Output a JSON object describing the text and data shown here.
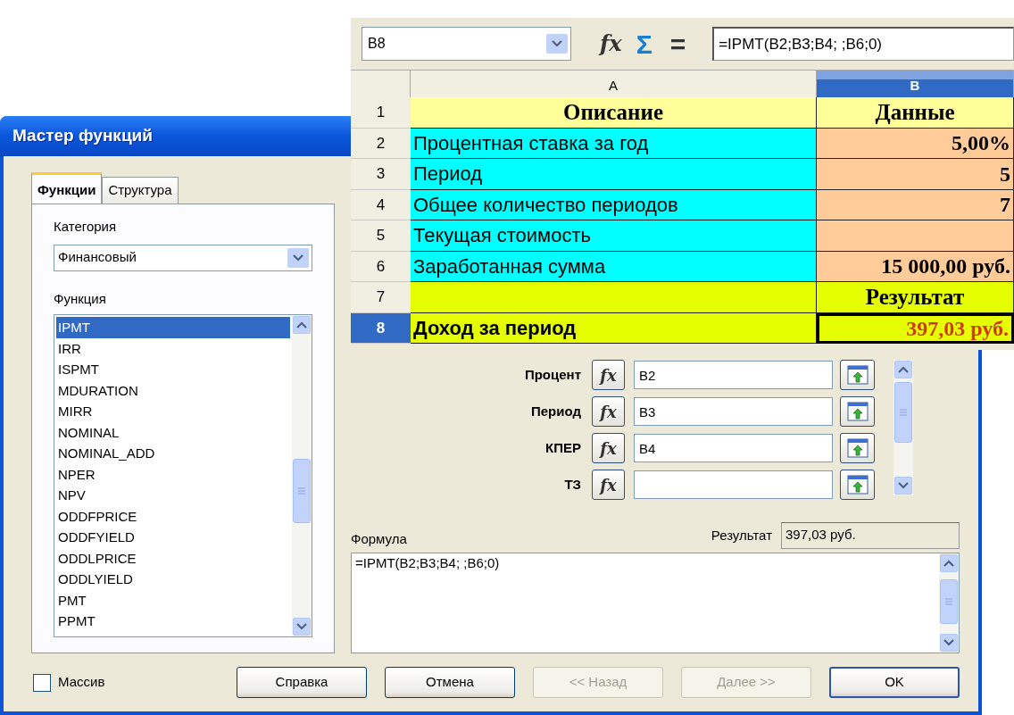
{
  "dialog": {
    "title": "Мастер функций",
    "tabs": [
      {
        "label": "Функции",
        "selected": true
      },
      {
        "label": "Структура",
        "selected": false
      }
    ],
    "category": {
      "label": "Категория",
      "value": "Финансовый"
    },
    "function_list": {
      "label": "Функция",
      "items": [
        {
          "label": "IPMT",
          "selected": true
        },
        {
          "label": "IRR",
          "selected": false
        },
        {
          "label": "ISPMT",
          "selected": false
        },
        {
          "label": "MDURATION",
          "selected": false
        },
        {
          "label": "MIRR",
          "selected": false
        },
        {
          "label": "NOMINAL",
          "selected": false
        },
        {
          "label": "NOMINAL_ADD",
          "selected": false
        },
        {
          "label": "NPER",
          "selected": false
        },
        {
          "label": "NPV",
          "selected": false
        },
        {
          "label": "ODDFPRICE",
          "selected": false
        },
        {
          "label": "ODDFYIELD",
          "selected": false
        },
        {
          "label": "ODDLPRICE",
          "selected": false
        },
        {
          "label": "ODDLYIELD",
          "selected": false
        },
        {
          "label": "PMT",
          "selected": false
        },
        {
          "label": "PPMT",
          "selected": false
        }
      ]
    },
    "array_checkbox": {
      "label": "Массив",
      "checked": false
    },
    "arguments": [
      {
        "label": "Процент",
        "fx": "fx",
        "value": "B2"
      },
      {
        "label": "Период",
        "fx": "fx",
        "value": "B3"
      },
      {
        "label": "КПЕР",
        "fx": "fx",
        "value": "B4"
      },
      {
        "label": "ТЗ",
        "fx": "fx"
      }
    ],
    "formula": {
      "label": "Формула",
      "value": "=IPMT(B2;B3;B4; ;B6;0)"
    },
    "result": {
      "label": "Результат",
      "value": "397,03 руб."
    },
    "buttons": [
      {
        "label": "Справка",
        "disabled": false,
        "default": false
      },
      {
        "label": "Отмена",
        "disabled": false,
        "default": false
      },
      {
        "label": "<< Назад",
        "disabled": true,
        "default": false
      },
      {
        "label": "Далее >>",
        "disabled": true,
        "default": false
      },
      {
        "label": "OK",
        "disabled": false,
        "default": true
      }
    ]
  },
  "sheet": {
    "name_box": "B8",
    "fx": "fx",
    "sum": "Σ",
    "equals": "=",
    "formula": "=IPMT(B2;B3;B4; ;B6;0)",
    "columns": [
      {
        "label": "A",
        "selected": false
      },
      {
        "label": "B",
        "selected": true
      }
    ],
    "rows": [
      {
        "number": "1",
        "selected": false,
        "cells": [
          {
            "text": "Описание",
            "kind": "header",
            "color": "#ffff99",
            "active": false
          },
          {
            "text": "Данные",
            "kind": "header",
            "color": "#ffff99",
            "active": false
          }
        ]
      },
      {
        "number": "2",
        "selected": false,
        "cells": [
          {
            "text": "Процентная ставка за год",
            "kind": "label",
            "color": "#00ffff",
            "active": false
          },
          {
            "text": "5,00%",
            "kind": "value",
            "color": "#ffcc99",
            "active": false
          }
        ]
      },
      {
        "number": "3",
        "selected": false,
        "cells": [
          {
            "text": "Период",
            "kind": "label",
            "color": "#00ffff",
            "active": false
          },
          {
            "text": "5",
            "kind": "value",
            "color": "#ffcc99",
            "active": false
          }
        ]
      },
      {
        "number": "4",
        "selected": false,
        "cells": [
          {
            "text": "Общее количество периодов",
            "kind": "label",
            "color": "#00ffff",
            "active": false
          },
          {
            "text": "7",
            "kind": "value",
            "color": "#ffcc99",
            "active": false
          }
        ]
      },
      {
        "number": "5",
        "selected": false,
        "cells": [
          {
            "text": "Текущая стоимость",
            "kind": "label",
            "color": "#00ffff",
            "active": false
          },
          {
            "kind": "value",
            "color": "#ffcc99",
            "active": false
          }
        ]
      },
      {
        "number": "6",
        "selected": false,
        "cells": [
          {
            "text": "Заработанная сумма",
            "kind": "label",
            "color": "#00ffff",
            "active": false
          },
          {
            "text": "15 000,00 руб.",
            "kind": "value",
            "color": "#ffcc99",
            "active": false
          }
        ]
      },
      {
        "number": "7",
        "selected": false,
        "cells": [
          {
            "kind": "label",
            "color": "#e6ff00",
            "active": false
          },
          {
            "text": "Результат",
            "kind": "header",
            "color": "#e6ff00",
            "active": false
          }
        ]
      },
      {
        "number": "8",
        "selected": true,
        "cells": [
          {
            "text": "Доход за период",
            "kind": "total",
            "color": "#e6ff00",
            "active": false
          },
          {
            "text": "397,03 руб.",
            "kind": "result",
            "color": "#e6ff00",
            "active": true
          }
        ]
      }
    ]
  }
}
